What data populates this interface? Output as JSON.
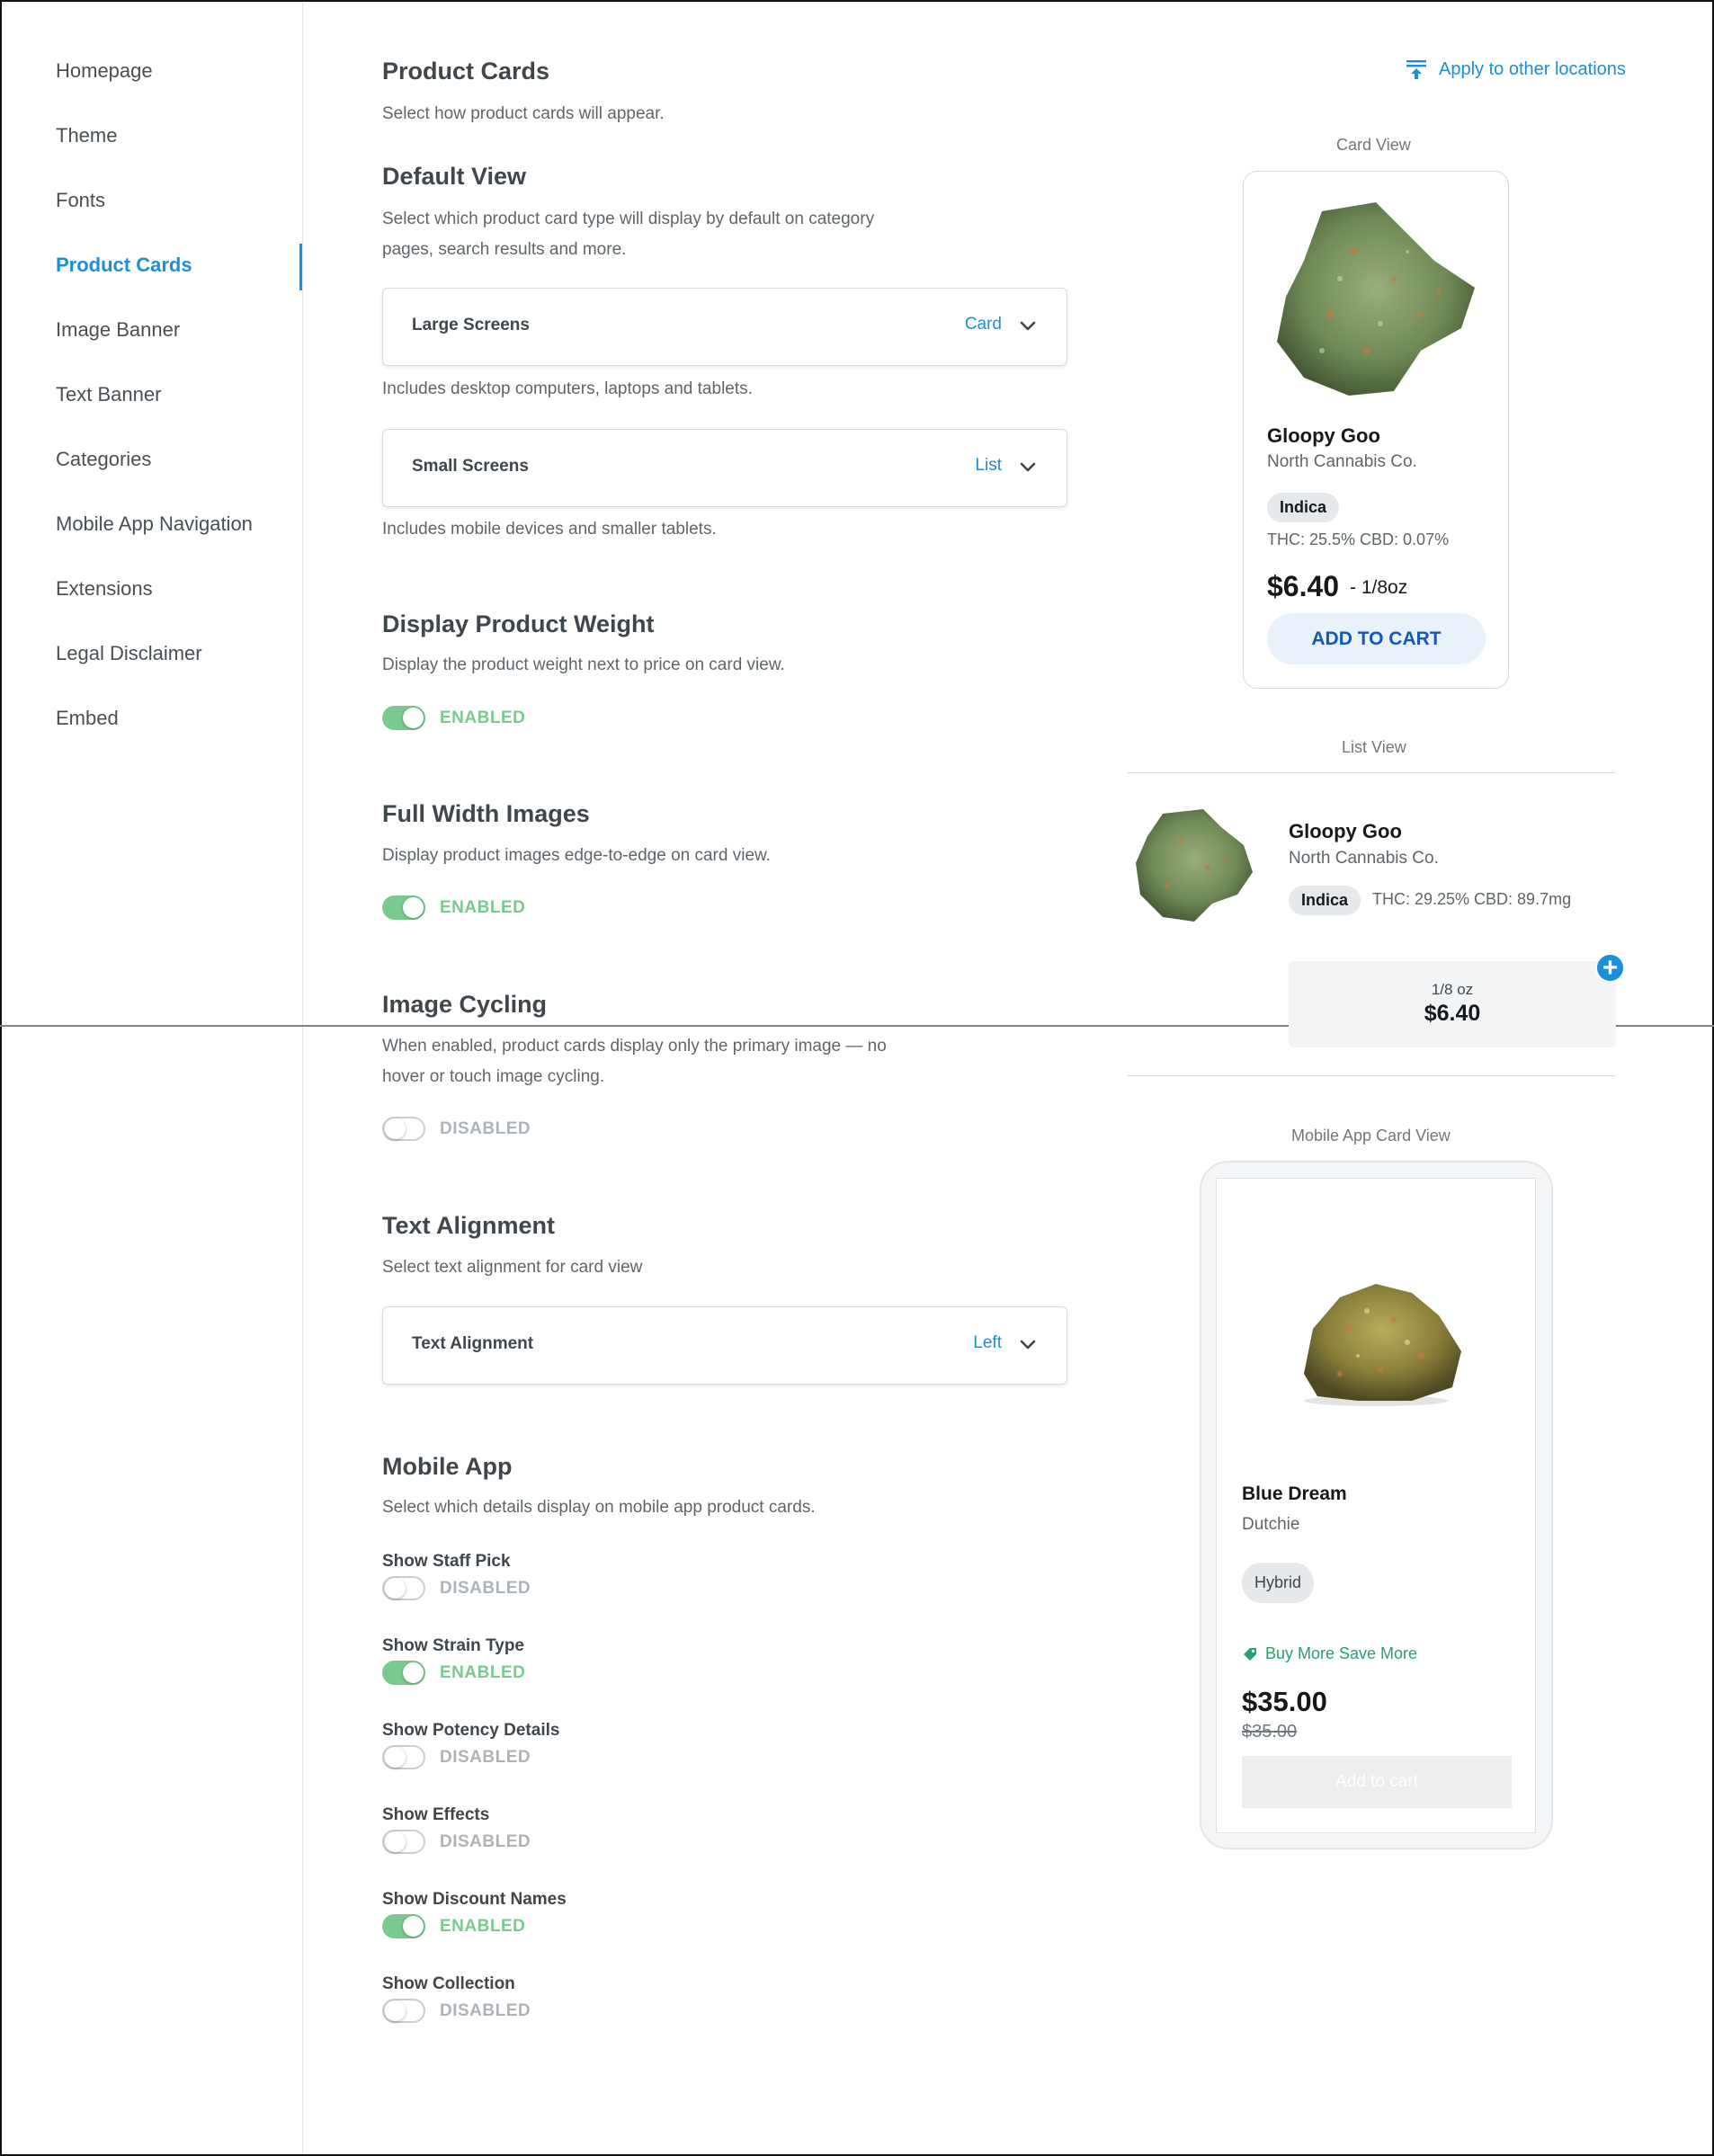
{
  "sidebar": {
    "items": [
      {
        "label": "Homepage"
      },
      {
        "label": "Theme"
      },
      {
        "label": "Fonts"
      },
      {
        "label": "Product Cards"
      },
      {
        "label": "Image Banner"
      },
      {
        "label": "Text Banner"
      },
      {
        "label": "Categories"
      },
      {
        "label": "Mobile App Navigation"
      },
      {
        "label": "Extensions"
      },
      {
        "label": "Legal Disclaimer"
      },
      {
        "label": "Embed"
      }
    ],
    "active_index": 3
  },
  "header": {
    "title": "Product Cards",
    "subtitle": "Select how product cards will appear.",
    "apply_label": "Apply to other locations"
  },
  "default_view": {
    "title": "Default View",
    "description_line1": "Select which product card type will display by default on category",
    "description_line2": "pages, search results and more.",
    "large": {
      "label": "Large Screens",
      "value": "Card",
      "help": "Includes desktop computers, laptops and tablets."
    },
    "small": {
      "label": "Small Screens",
      "value": "List",
      "help": "Includes mobile devices and smaller tablets."
    }
  },
  "display_weight": {
    "title": "Display Product Weight",
    "description": "Display the product weight next to price on card view.",
    "status": "ENABLED"
  },
  "full_width": {
    "title": "Full Width Images",
    "description": "Display product images edge-to-edge on card view.",
    "status": "ENABLED"
  },
  "image_cycling": {
    "title": "Image Cycling",
    "description_line1": "When enabled, product cards display only the primary image — no",
    "description_line2": "hover or touch image cycling.",
    "status": "DISABLED"
  },
  "text_alignment": {
    "title": "Text Alignment",
    "description": "Select text alignment for card view",
    "label": "Text Alignment",
    "value": "Left"
  },
  "mobile_app": {
    "title": "Mobile App",
    "description": "Select which details display on mobile app product cards.",
    "options": [
      {
        "label": "Show Staff Pick",
        "status": "DISABLED"
      },
      {
        "label": "Show Strain Type",
        "status": "ENABLED"
      },
      {
        "label": "Show Potency Details",
        "status": "DISABLED"
      },
      {
        "label": "Show Effects",
        "status": "DISABLED"
      },
      {
        "label": "Show Discount Names",
        "status": "ENABLED"
      },
      {
        "label": "Show Collection",
        "status": "DISABLED"
      }
    ]
  },
  "preview": {
    "card_view": {
      "label": "Card View",
      "name": "Gloopy Goo",
      "brand": "North Cannabis Co.",
      "strain": "Indica",
      "potency": "THC: 25.5%  CBD: 0.07%",
      "price": "$6.40",
      "weight": "- 1/8oz",
      "button": "ADD TO CART"
    },
    "list_view": {
      "label": "List View",
      "name": "Gloopy Goo",
      "brand": "North Cannabis Co.",
      "strain": "Indica",
      "potency": "THC: 29.25%   CBD: 89.7mg",
      "weight": "1/8 oz",
      "price": "$6.40"
    },
    "mobile_view": {
      "label": "Mobile App Card View",
      "name": "Blue Dream",
      "brand": "Dutchie",
      "strain": "Hybrid",
      "discount": "Buy More Save More",
      "price": "$35.00",
      "original_price": "$35.00",
      "button": "Add to cart"
    }
  },
  "colors": {
    "accent": "#1c8fd6",
    "enabled": "#7ac98f",
    "disabled": "#adb4b9",
    "discount": "#2aa06a"
  },
  "icons": {
    "apply": "upload-stack-icon",
    "chevron": "chevron-down-icon",
    "plus": "plus-circle-icon",
    "tag": "tag-icon"
  }
}
